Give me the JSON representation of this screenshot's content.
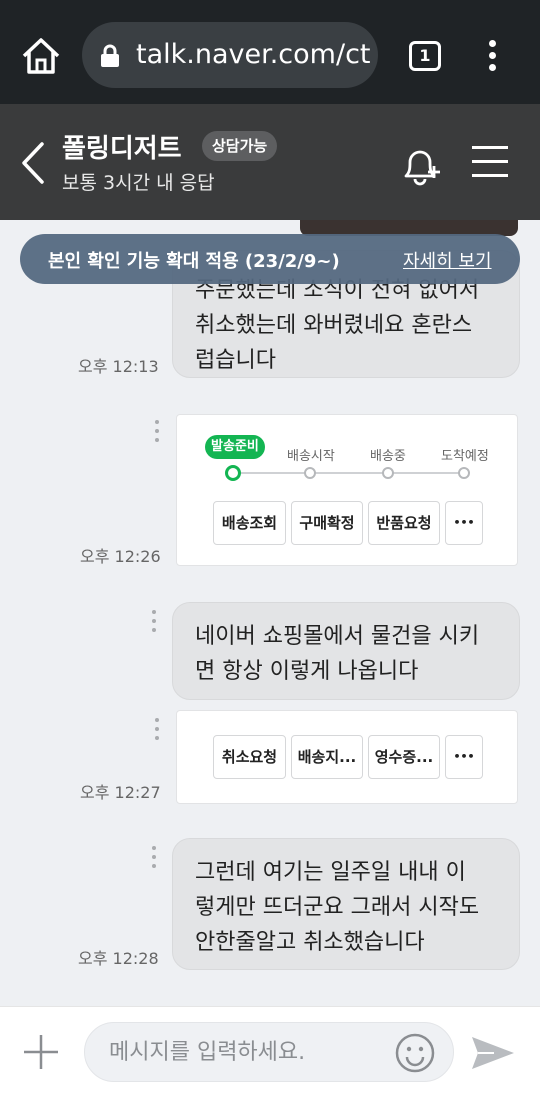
{
  "browser": {
    "url": "talk.naver.com/ct",
    "tab_count": "1"
  },
  "header": {
    "store_name": "폴링디저트",
    "status_badge": "상담가능",
    "response_time": "보통 3시간 내 응답"
  },
  "notice": {
    "text": "본인 확인 기능 확대 적용 (23/2/9~)",
    "link": "자세히 보기"
  },
  "messages": [
    {
      "text": "주문했는데 소식이 전혀 없어서 취소했는데 와버렸네요 혼란스럽습니다",
      "time": "오후 12:13"
    },
    {
      "text": "네이버 쇼핑몰에서 물건을 시키면 항상 이렇게 나옵니다",
      "time": "오후 12:27"
    },
    {
      "text": "그런데 여기는 일주일 내내 이렇게만 뜨더군요 그래서 시작도 안한줄알고 취소했습니다",
      "time": "오후 12:28"
    }
  ],
  "messages_partial": {
    "line1": "주문했는데 소식이 전혀 없어서",
    "line2": "취소했는데 와버렸네요 혼란스",
    "line3": "럽습니다"
  },
  "message2_lines": {
    "line1": "네이버 쇼핑몰에서 물건을 시키",
    "line2": "면 항상 이렇게 나옵니다"
  },
  "message3_lines": {
    "line1": "그런데 여기는 일주일 내내 이",
    "line2": "렇게만 뜨더군요 그래서 시작도",
    "line3": "안한줄알고 취소했습니다"
  },
  "delivery_card": {
    "time": "오후 12:26",
    "stages": [
      "발송준비",
      "배송시작",
      "배송중",
      "도착예정"
    ],
    "active_stage": 0,
    "buttons": [
      "배송조회",
      "구매확정",
      "반품요청",
      "•••"
    ]
  },
  "action_card": {
    "buttons": [
      "취소요청",
      "배송지...",
      "영수증...",
      "•••"
    ]
  },
  "input": {
    "placeholder": "메시지를 입력하세요."
  }
}
